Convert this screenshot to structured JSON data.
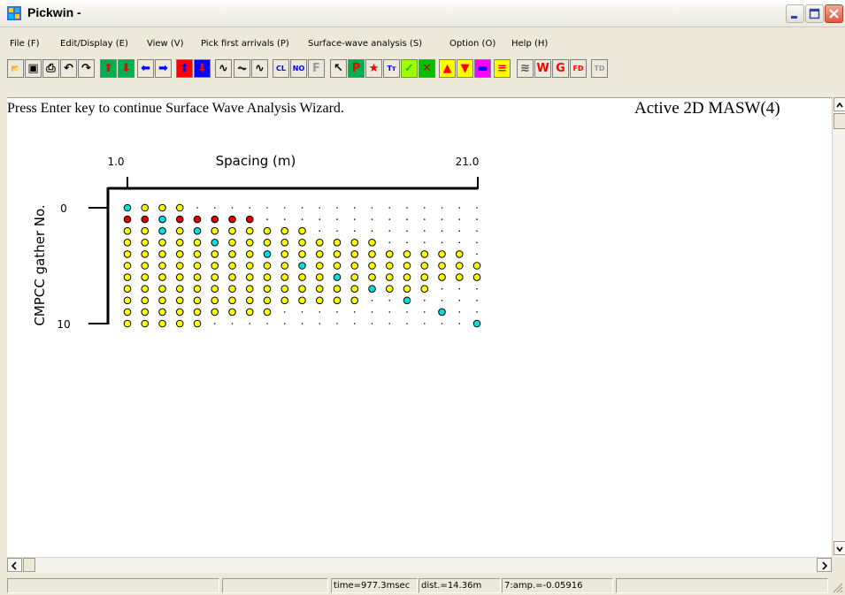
{
  "window": {
    "title": "Pickwin -",
    "controls": [
      "minimize",
      "maximize",
      "close"
    ]
  },
  "menu": [
    "File (F)",
    "Edit/Display (E)",
    "View (V)",
    "Pick first arrivals (P)",
    "Surface-wave analysis (S)",
    "Option (O)",
    "Help (H)"
  ],
  "toolbar": {
    "buttons": [
      {
        "name": "open-icon",
        "glyph": "📂",
        "color": "#d7a300"
      },
      {
        "name": "save-icon",
        "glyph": "▣",
        "color": "#000000"
      },
      {
        "name": "print-icon",
        "glyph": "⎙",
        "color": "#000000"
      },
      {
        "name": "undo-icon",
        "glyph": "↶",
        "color": "#000000"
      },
      {
        "name": "redo-icon",
        "glyph": "↷",
        "color": "#000000"
      },
      {
        "name": "arrow-up-icon",
        "glyph": "⬆",
        "color": "#ff0000",
        "bg": "#00b050"
      },
      {
        "name": "arrow-down-icon",
        "glyph": "⬇",
        "color": "#ff0000",
        "bg": "#00b050"
      },
      {
        "name": "arrow-left-icon",
        "glyph": "⬅",
        "color": "#0000ff",
        "bg": "#ece9d8"
      },
      {
        "name": "arrow-right-icon",
        "glyph": "➡",
        "color": "#0000ff",
        "bg": "#ece9d8"
      },
      {
        "name": "shift-up-icon",
        "glyph": "⬆",
        "color": "#0000ff",
        "bg": "#ff0000"
      },
      {
        "name": "shift-down-icon",
        "glyph": "⬇",
        "color": "#ff0000",
        "bg": "#0000ff"
      },
      {
        "name": "wave-icon",
        "glyph": "∿",
        "color": "#000000"
      },
      {
        "name": "wave-fill-icon",
        "glyph": "⏦",
        "color": "#000000"
      },
      {
        "name": "wave-var-icon",
        "glyph": "∿",
        "color": "#000000"
      },
      {
        "name": "clip-icon",
        "glyph": "CL",
        "color": "#0000ff"
      },
      {
        "name": "norm-icon",
        "glyph": "NO",
        "color": "#0000ff"
      },
      {
        "name": "filter-icon",
        "glyph": "F",
        "color": "#9a9a9a"
      },
      {
        "name": "pointer-icon",
        "glyph": "↖",
        "color": "#000000"
      },
      {
        "name": "pick-p-icon",
        "glyph": "P",
        "color": "#ff0000",
        "bg": "#00b050"
      },
      {
        "name": "pick-star-icon",
        "glyph": "★",
        "color": "#ff0000"
      },
      {
        "name": "text-icon",
        "glyph": "Tт",
        "color": "#0000ff"
      },
      {
        "name": "check-green-icon",
        "glyph": "✓",
        "color": "#00a000",
        "bg": "#9cff00"
      },
      {
        "name": "cross-icon",
        "glyph": "✕",
        "color": "#c00000",
        "bg": "#00c000"
      },
      {
        "name": "triangle-up-icon",
        "glyph": "▲",
        "color": "#ff0000",
        "bg": "#ffff00"
      },
      {
        "name": "triangle-down-icon",
        "glyph": "▼",
        "color": "#ff0000",
        "bg": "#ffff00"
      },
      {
        "name": "color-bar-icon",
        "glyph": "▬",
        "color": "#0000ff",
        "bg": "#ff00ff"
      },
      {
        "name": "color-scale-icon",
        "glyph": "≡",
        "color": "#ff0000",
        "bg": "#ffff00"
      },
      {
        "name": "wiggle-icon",
        "glyph": "≋",
        "color": "#555555"
      },
      {
        "name": "w-icon",
        "glyph": "W",
        "color": "#ff0000"
      },
      {
        "name": "g-icon",
        "glyph": "G",
        "color": "#ff0000"
      },
      {
        "name": "fd-icon",
        "glyph": "FD",
        "color": "#ff0000"
      },
      {
        "name": "td-icon",
        "glyph": "TD",
        "color": "#9a9a9a"
      }
    ]
  },
  "content": {
    "message": "Press Enter key to continue Surface Wave Analysis Wizard.",
    "mode": "Active 2D MASW(4)"
  },
  "chart_data": {
    "type": "scatter",
    "title": "",
    "xlabel": "Spacing (m)",
    "ylabel": "CMPCC gather No.",
    "x_ticks": [
      "1.0",
      "21.0"
    ],
    "y_ticks": [
      "0",
      "10"
    ],
    "columns": 21,
    "rows": 11,
    "legend": "none",
    "colors": {
      "y": "#ffff00",
      "c": "#00e0e0",
      "r": "#e00000",
      ".": "#000000"
    },
    "grid": [
      "cyyy.................",
      "rrcrrrrr.............",
      "yycycyyyyyy..........",
      "yyyyycyyyyyyyyy......",
      "yyyyyyyycyyyyyyyyyyy.",
      "yyyyyyyyyycyyyyyyyyyy",
      "yyyyyyyyyyyycyyyyyyyy",
      "yyyyyyyyyyyyyycyyy...",
      "yyyyyyyyyyyyyy..c....",
      "yyyyyyyyy.........c..",
      "yyyyy...............c"
    ]
  },
  "status": {
    "panes": [
      "",
      "",
      "time=977.3msec",
      "dist.=14.36m",
      "7:amp.=-0.05916",
      ""
    ]
  }
}
